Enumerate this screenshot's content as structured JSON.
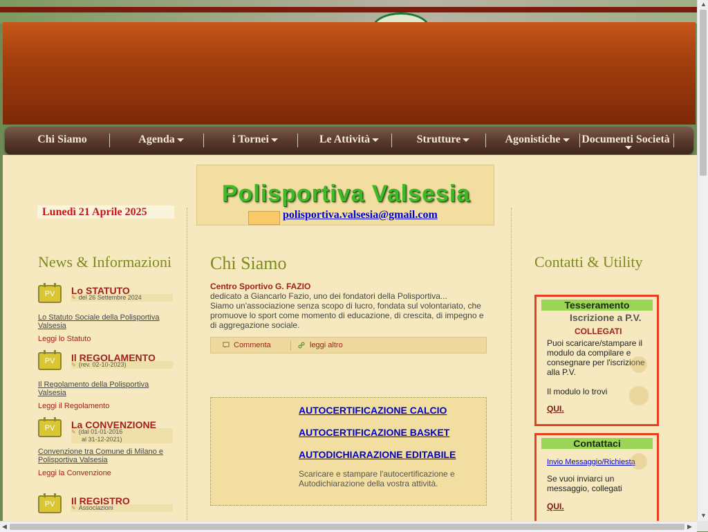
{
  "nav": {
    "items": [
      {
        "label": "Chi Siamo",
        "dropdown": false
      },
      {
        "label": "Agenda",
        "dropdown": true
      },
      {
        "label": "i Tornei",
        "dropdown": true
      },
      {
        "label": "Le Attività",
        "dropdown": true
      },
      {
        "label": "Strutture",
        "dropdown": true
      },
      {
        "label": "Agonistiche",
        "dropdown": true
      },
      {
        "label": "Documenti Società",
        "dropdown": true
      }
    ]
  },
  "date": "Lunedì 21 Aprile 2025",
  "site": {
    "title": "Polisportiva Valsesia",
    "email": "polisportiva.valsesia@gmail.com"
  },
  "left": {
    "heading": "News & Informazioni",
    "news": [
      {
        "badge": "PV",
        "title": "Lo STATUTO",
        "date": "del 26 Settembre 2024",
        "desc": "Lo Statuto Sociale della Polisportiva Valsesia",
        "link": "Leggi lo Statuto"
      },
      {
        "badge": "PV",
        "title": "Il REGOLAMENTO",
        "date": "(rev. 02-10-2023)",
        "desc": "Il Regolamento della Polisportiva Valsesia",
        "link": "Leggi il Regolamento"
      },
      {
        "badge": "PV",
        "title": "La CONVENZIONE",
        "date": "(dal 01-01-2016",
        "date2": "al 31-12-2021)",
        "desc": "Convenzione tra Comune di Milano e Polisportiva Valsesia",
        "link": "Leggi la Convenzione"
      },
      {
        "badge": "PV",
        "title": "Il REGISTRO",
        "date": "Associazioni"
      }
    ]
  },
  "main": {
    "heading": "Chi Siamo",
    "subtitle": "Centro Sportivo G. FAZIO",
    "text": "dedicato a Giancarlo Fazio, uno dei fondatori della Polisportiva...\nSiamo un'associazione senza scopo di lucro, fondata sul volontariato, che promuove lo sport come momento di educazione, di crescita, di impegno e di aggregazione sociale.",
    "comment_label": "Commenta",
    "readmore_label": "leggi altro",
    "docs": [
      "AUTOCERTIFICAZIONE CALCIO",
      "AUTOCERTIFICAZIONE BASKET",
      "AUTODICHIARAZIONE EDITABILE"
    ],
    "docs_text": "Scaricare e stampare l'autocertificazione e Autodichiarazione della vostra attività."
  },
  "right": {
    "heading": "Contatti & Utility",
    "box1": {
      "title": "Tesseramento",
      "sub": "Iscrizione a P.V.",
      "red": "COLLEGATI",
      "text": "Puoi scaricare/stampare il modulo da compilare e consegnare per l'iscrizione alla P.V.",
      "text2": "Il modulo lo trovi",
      "link": "QUI."
    },
    "box2": {
      "title": "Contattaci",
      "link_top": "Invio Messaggio/Richiesta",
      "text": "Se vuoi inviarci un messaggio, collegati",
      "link": "QUI."
    }
  }
}
